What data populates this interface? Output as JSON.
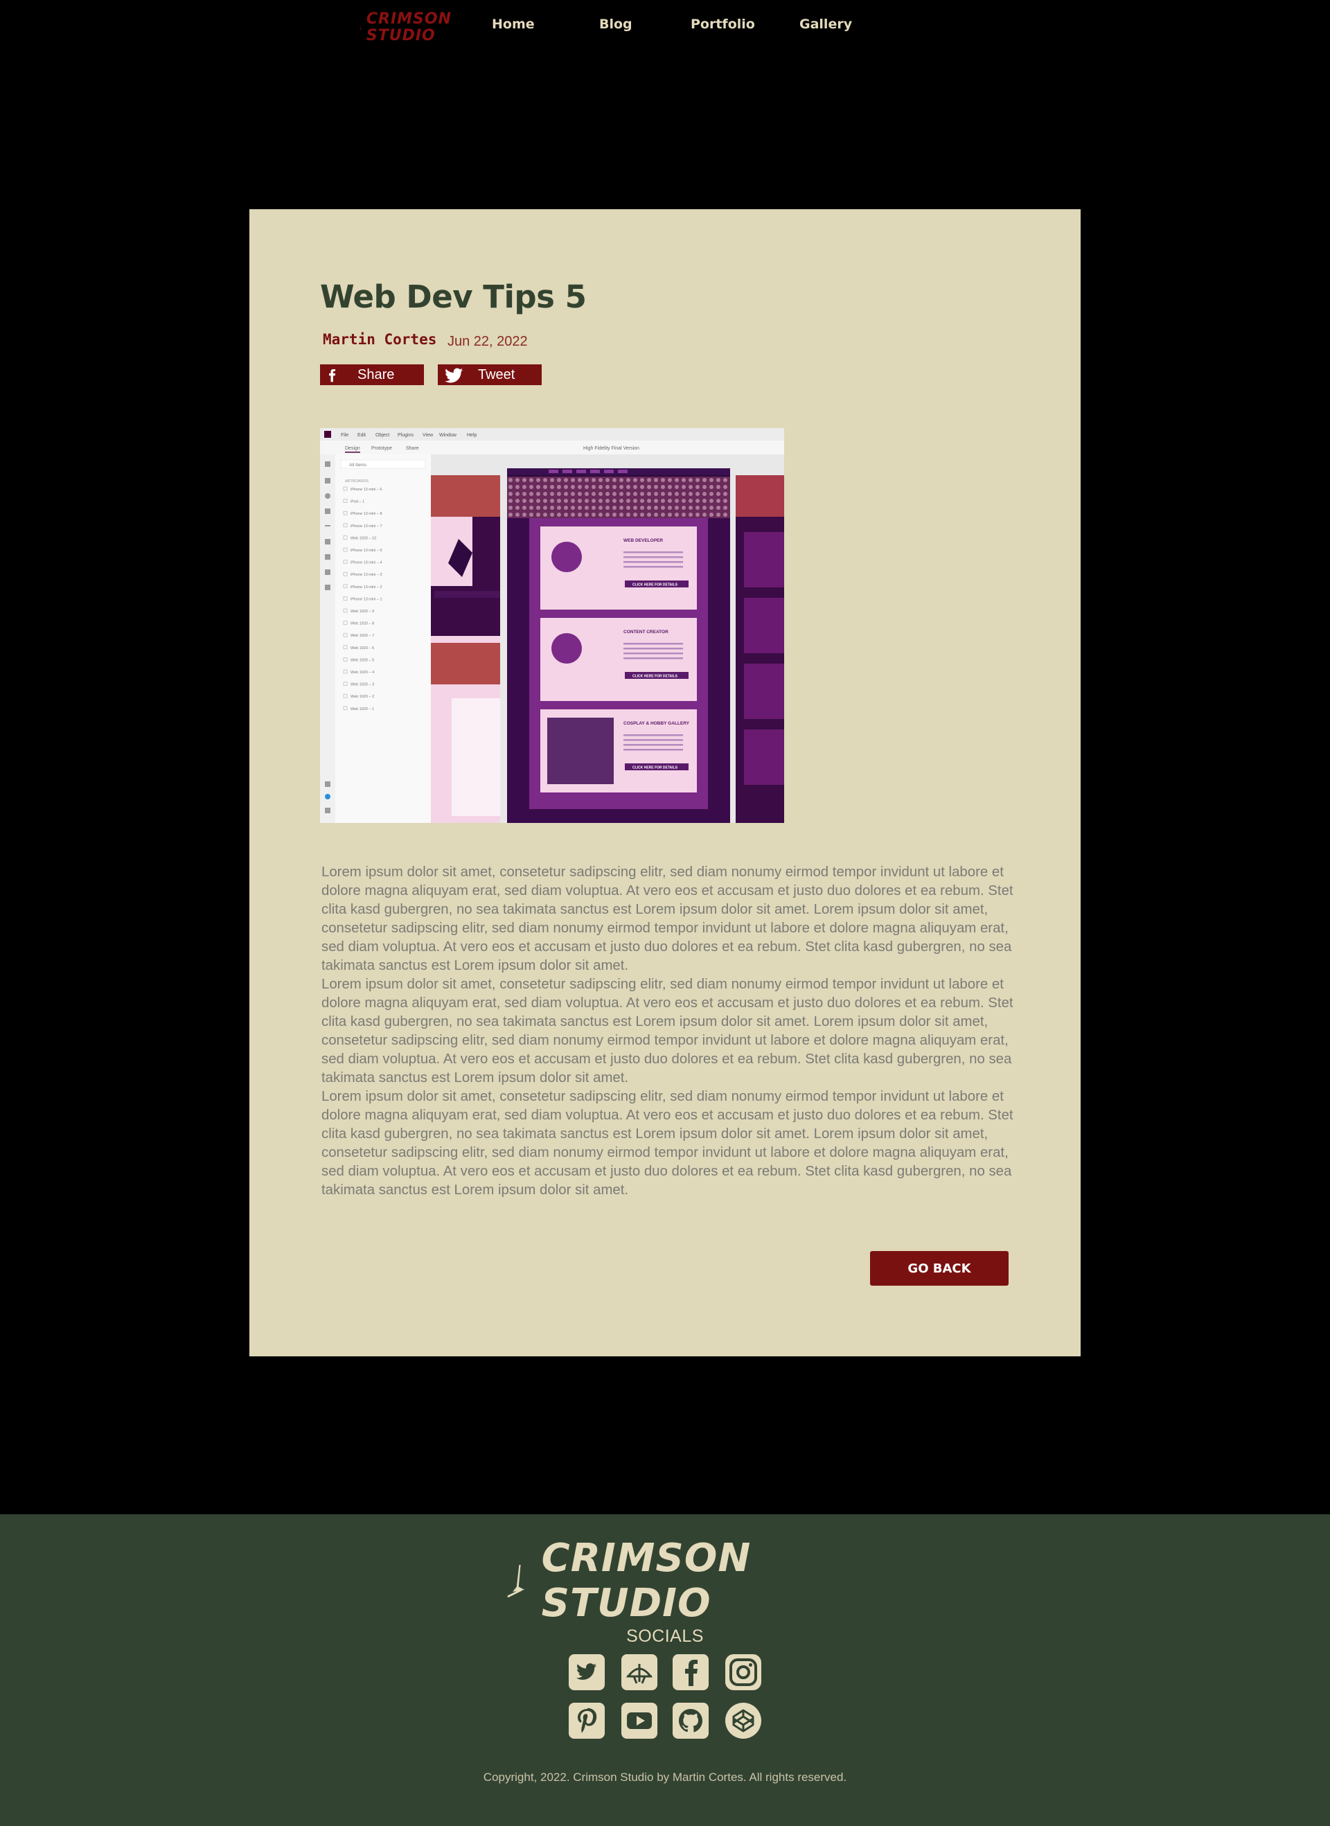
{
  "nav": {
    "logo_line1": "CRIMSON",
    "logo_line2": "STUDIO",
    "items": [
      "Home",
      "Blog",
      "Portfolio",
      "Gallery"
    ]
  },
  "post": {
    "title": "Web Dev Tips 5",
    "author": "Martin Cortes",
    "date": "Jun 22, 2022",
    "share_label": "Share",
    "tweet_label": "Tweet",
    "paragraphs": [
      "Lorem ipsum dolor sit amet, consetetur sadipscing elitr, sed diam nonumy eirmod tempor invidunt ut labore et dolore magna aliquyam erat, sed diam voluptua. At vero eos et accusam et justo duo dolores et ea rebum. Stet clita kasd gubergren, no sea takimata sanctus est Lorem ipsum dolor sit amet. Lorem ipsum dolor sit amet, consetetur sadipscing elitr, sed diam nonumy eirmod tempor invidunt ut labore et dolore magna aliquyam erat, sed diam voluptua. At vero eos et accusam et justo duo dolores et ea rebum. Stet clita kasd gubergren, no sea takimata sanctus est Lorem ipsum dolor sit amet.",
      "Lorem ipsum dolor sit amet, consetetur sadipscing elitr, sed diam nonumy eirmod tempor invidunt ut labore et dolore magna aliquyam erat, sed diam voluptua. At vero eos et accusam et justo duo dolores et ea rebum. Stet clita kasd gubergren, no sea takimata sanctus est Lorem ipsum dolor sit amet. Lorem ipsum dolor sit amet, consetetur sadipscing elitr, sed diam nonumy eirmod tempor invidunt ut labore et dolore magna aliquyam erat, sed diam voluptua. At vero eos et accusam et justo duo dolores et ea rebum. Stet clita kasd gubergren, no sea takimata sanctus est Lorem ipsum dolor sit amet.",
      "Lorem ipsum dolor sit amet, consetetur sadipscing elitr, sed diam nonumy eirmod tempor invidunt ut labore et dolore magna aliquyam erat, sed diam voluptua. At vero eos et accusam et justo duo dolores et ea rebum. Stet clita kasd gubergren, no sea takimata sanctus est Lorem ipsum dolor sit amet. Lorem ipsum dolor sit amet, consetetur sadipscing elitr, sed diam nonumy eirmod tempor invidunt ut labore et dolore magna aliquyam erat, sed diam voluptua. At vero eos et accusam et justo duo dolores et ea rebum. Stet clita kasd gubergren, no sea takimata sanctus est Lorem ipsum dolor sit amet."
    ],
    "go_back_label": "GO BACK"
  },
  "hero_image": {
    "menu": [
      "File",
      "Edit",
      "Object",
      "Plugins",
      "View",
      "Window",
      "Help"
    ],
    "tabs": [
      "Design",
      "Prototype",
      "Share"
    ],
    "doc_title": "High Fidelity Final Version",
    "search": "All Items",
    "group": "ARTBOARDS",
    "artboards": [
      "iPhone 13 mini – 6",
      "iPad – 1",
      "iPhone 13 mini – 8",
      "iPhone 13 mini – 7",
      "Web 1920 – 10",
      "iPhone 13 mini – 5",
      "iPhone 13 mini – 4",
      "iPhone 13 mini – 3",
      "iPhone 13 mini – 2",
      "iPhone 13 mini – 1",
      "Web 1920 – 9",
      "Web 1920 – 8",
      "Web 1920 – 7",
      "Web 1920 – 6",
      "Web 1920 – 5",
      "Web 1920 – 4",
      "Web 1920 – 3",
      "Web 1920 – 2",
      "Web 1920 – 1"
    ],
    "cards": [
      {
        "title": "WEB DEVELOPER",
        "button": "CLICK HERE FOR DETAILS"
      },
      {
        "title": "CONTENT CREATOR",
        "button": "CLICK HERE FOR DETAILS"
      },
      {
        "title": "COSPLAY & HOBBY GALLERY",
        "button": "CLICK HERE FOR DETAILS"
      }
    ]
  },
  "footer": {
    "logo_text": "CRIMSON STUDIO",
    "socials_title": "SOCIALS",
    "socials": [
      "twitter-icon",
      "dev-icon",
      "facebook-icon",
      "instagram-icon",
      "pinterest-icon",
      "youtube-icon",
      "github-icon",
      "codepen-icon"
    ],
    "copyright": "Copyright, 2022. Crimson Studio by Martin Cortes. All rights reserved."
  },
  "colors": {
    "accent": "#7a1111",
    "card_bg": "#dfd8b9",
    "footer_bg": "#334331",
    "cream": "#e4dbbd"
  }
}
